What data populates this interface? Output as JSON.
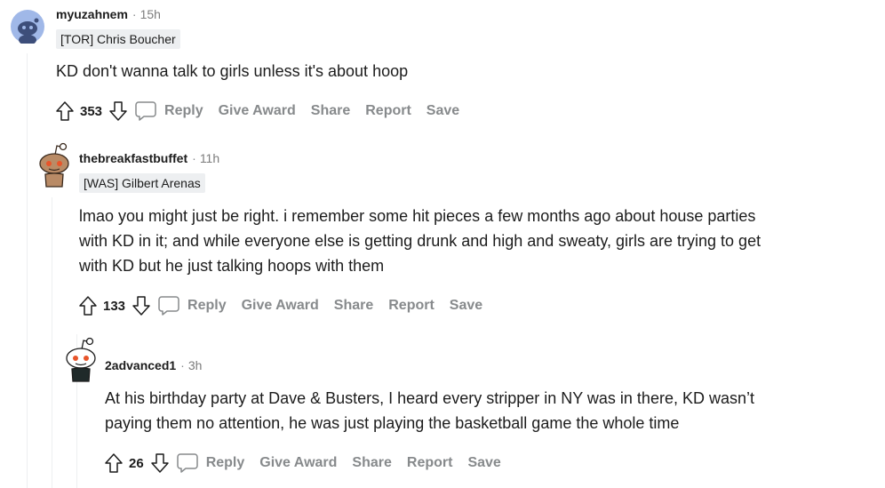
{
  "comments": [
    {
      "username": "myuzahnem",
      "time": "15h",
      "flair": "[TOR] Chris Boucher",
      "body": [
        "KD don't wanna talk to girls unless it's about hoop"
      ],
      "score": "353",
      "avatar": "blue-default-snoo-avatar"
    },
    {
      "username": "thebreakfastbuffet",
      "time": "11h",
      "flair": "[WAS] Gilbert Arenas",
      "body": [
        "lmao you might just be right. i remember some hit pieces a few months ago about house parties",
        "with KD in it; and while everyone else is getting drunk and high and sweaty, girls are trying to get",
        "with KD but he just talking hoops with them"
      ],
      "score": "133",
      "avatar": "brown-snoo-avatar"
    },
    {
      "username": "2advanced1",
      "time": "3h",
      "flair": "",
      "body": [
        "At his birthday party at Dave & Busters, I heard every stripper in NY was in there, KD wasn’t",
        "paying them no attention, he was just playing the basketball game the whole time"
      ],
      "score": "26",
      "avatar": "white-snoo-avatar"
    }
  ],
  "actions": {
    "dot": "·",
    "reply": "Reply",
    "give_award": "Give Award",
    "share": "Share",
    "report": "Report",
    "save": "Save"
  },
  "colors": {
    "text": "#1c1c1c",
    "muted": "#878a8c",
    "flair_bg": "#edeff1",
    "thread_line": "#edeff1",
    "avatar_blue": "#a0b8e8"
  }
}
